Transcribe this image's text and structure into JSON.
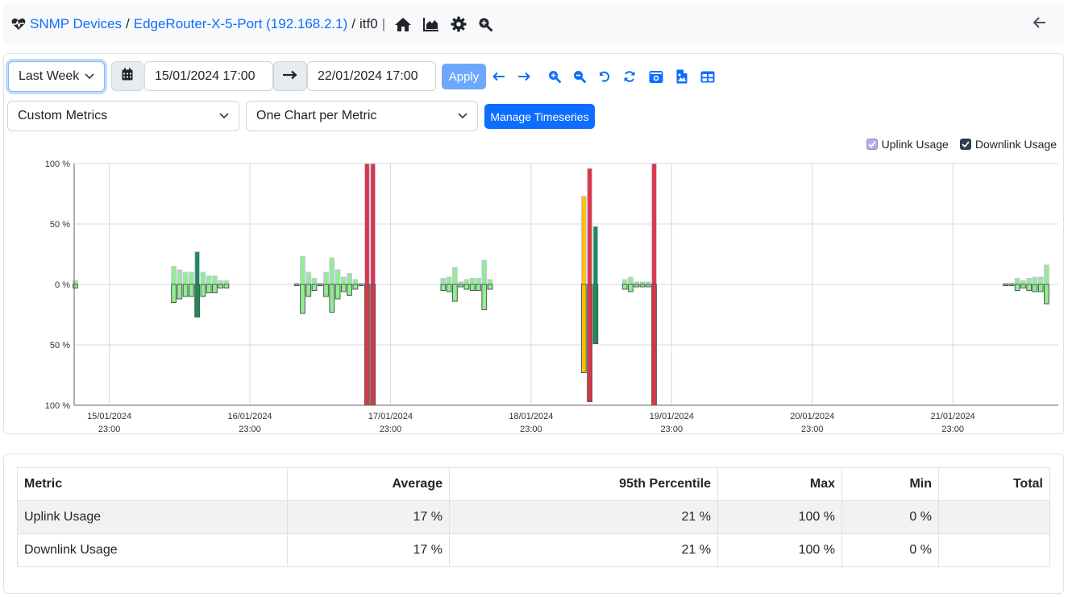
{
  "breadcrumb": {
    "icon": "heartbeat-icon",
    "items": [
      {
        "label": "SNMP Devices",
        "link": true
      },
      {
        "label": "EdgeRouter-X-5-Port (192.168.2.1)",
        "link": true
      },
      {
        "label": "itf0",
        "link": false
      }
    ],
    "separator": "/",
    "divider": "|",
    "nav_icons": [
      "home-icon",
      "area-chart-icon",
      "gear-icon",
      "search-plus-icon"
    ],
    "back_icon": "arrow-left-icon"
  },
  "toolbar": {
    "range_select": "Last Week",
    "calendar_icon": "calendar-icon",
    "start": "15/01/2024 17:00",
    "arrow_icon": "long-arrow-right-icon",
    "end": "22/01/2024 17:00",
    "apply_label": "Apply",
    "tools": [
      "arrow-left-icon",
      "arrow-right-icon",
      "zoom-in-icon",
      "zoom-out-icon",
      "undo-icon",
      "refresh-icon",
      "camera-icon",
      "file-image-icon",
      "table-icon"
    ],
    "metric_select": "Custom Metrics",
    "layout_select": "One Chart per Metric",
    "manage_label": "Manage Timeseries"
  },
  "legend": [
    {
      "label": "Uplink Usage",
      "checked": true,
      "color": "#b4b0e8"
    },
    {
      "label": "Downlink Usage",
      "checked": true,
      "color": "#2c3e50"
    }
  ],
  "colors": {
    "low": "#90ee90",
    "medium": "#1e8a57",
    "high": "#ffc107",
    "critical": "#dc3545",
    "uplink_border": "#c9c3e6",
    "downlink_border": "#4a5a52"
  },
  "chart_data": {
    "type": "bar",
    "title": "",
    "xlabel": "",
    "ylabel": "",
    "ylim": [
      -100,
      100
    ],
    "yticks": [
      "100 %",
      "50 %",
      "0 %",
      "50 %",
      "100 %"
    ],
    "ytick_values": [
      100,
      50,
      0,
      -50,
      -100
    ],
    "x_range_hours": [
      0,
      168
    ],
    "x_start": "15/01/2024 17:00",
    "xticks": [
      {
        "hour": 6,
        "label": [
          "15/01/2024",
          "23:00"
        ]
      },
      {
        "hour": 30,
        "label": [
          "16/01/2024",
          "23:00"
        ]
      },
      {
        "hour": 54,
        "label": [
          "17/01/2024",
          "23:00"
        ]
      },
      {
        "hour": 78,
        "label": [
          "18/01/2024",
          "23:00"
        ]
      },
      {
        "hour": 102,
        "label": [
          "19/01/2024",
          "23:00"
        ]
      },
      {
        "hour": 126,
        "label": [
          "20/01/2024",
          "23:00"
        ]
      },
      {
        "hour": 150,
        "label": [
          "21/01/2024",
          "23:00"
        ]
      }
    ],
    "grid": true,
    "legend_position": "top-right",
    "series": [
      {
        "name": "Uplink Usage",
        "direction": "up"
      },
      {
        "name": "Downlink Usage",
        "direction": "down"
      }
    ],
    "points": [
      {
        "hour": 0.2,
        "up": 3,
        "down": 3
      },
      {
        "hour": 17,
        "up": 15,
        "down": 15
      },
      {
        "hour": 18,
        "up": 12,
        "down": 12
      },
      {
        "hour": 19,
        "up": 10,
        "down": 10
      },
      {
        "hour": 20,
        "up": 10,
        "down": 10
      },
      {
        "hour": 21,
        "up": 27,
        "down": 27
      },
      {
        "hour": 22,
        "up": 10,
        "down": 10
      },
      {
        "hour": 23,
        "up": 7,
        "down": 7
      },
      {
        "hour": 24,
        "up": 7,
        "down": 7
      },
      {
        "hour": 25,
        "up": 3,
        "down": 3
      },
      {
        "hour": 26,
        "up": 3,
        "down": 3
      },
      {
        "hour": 38,
        "up": 0,
        "down": 0
      },
      {
        "hour": 39,
        "up": 23,
        "down": 24
      },
      {
        "hour": 40,
        "up": 10,
        "down": 10
      },
      {
        "hour": 41,
        "up": 5,
        "down": 5
      },
      {
        "hour": 42,
        "up": 1,
        "down": 1
      },
      {
        "hour": 43,
        "up": 10,
        "down": 10
      },
      {
        "hour": 44,
        "up": 22,
        "down": 23
      },
      {
        "hour": 45,
        "up": 12,
        "down": 12
      },
      {
        "hour": 46,
        "up": 6,
        "down": 6
      },
      {
        "hour": 47,
        "up": 9,
        "down": 9
      },
      {
        "hour": 48,
        "up": 4,
        "down": 4
      },
      {
        "hour": 49,
        "up": 1,
        "down": 1
      },
      {
        "hour": 50,
        "up": 100,
        "down": 100
      },
      {
        "hour": 51,
        "up": 100,
        "down": 100
      },
      {
        "hour": 63,
        "up": 5,
        "down": 5
      },
      {
        "hour": 64,
        "up": 6,
        "down": 6
      },
      {
        "hour": 65,
        "up": 14,
        "down": 14
      },
      {
        "hour": 66,
        "up": 2,
        "down": 2
      },
      {
        "hour": 67,
        "up": 4,
        "down": 4
      },
      {
        "hour": 68,
        "up": 5,
        "down": 5
      },
      {
        "hour": 69,
        "up": 5,
        "down": 5
      },
      {
        "hour": 70,
        "up": 20,
        "down": 21
      },
      {
        "hour": 71,
        "up": 4,
        "down": 4
      },
      {
        "hour": 87,
        "up": 73,
        "down": 73
      },
      {
        "hour": 88,
        "up": 96,
        "down": 97
      },
      {
        "hour": 89,
        "up": 48,
        "down": 49
      },
      {
        "hour": 94,
        "up": 4,
        "down": 4
      },
      {
        "hour": 95,
        "up": 6,
        "down": 6
      },
      {
        "hour": 96,
        "up": 2,
        "down": 2
      },
      {
        "hour": 97,
        "up": 2,
        "down": 2
      },
      {
        "hour": 98,
        "up": 2,
        "down": 2
      },
      {
        "hour": 99,
        "up": 100,
        "down": 100
      },
      {
        "hour": 159,
        "up": 0,
        "down": 0
      },
      {
        "hour": 160,
        "up": 0,
        "down": 0
      },
      {
        "hour": 161,
        "up": 5,
        "down": 5
      },
      {
        "hour": 162,
        "up": 3,
        "down": 3
      },
      {
        "hour": 163,
        "up": 5,
        "down": 5
      },
      {
        "hour": 164,
        "up": 6,
        "down": 6
      },
      {
        "hour": 165,
        "up": 6,
        "down": 6
      },
      {
        "hour": 166,
        "up": 16,
        "down": 16
      }
    ]
  },
  "stats_table": {
    "columns": [
      "Metric",
      "Average",
      "95th Percentile",
      "Max",
      "Min",
      "Total"
    ],
    "rows": [
      [
        "Uplink Usage",
        "17 %",
        "21 %",
        "100 %",
        "0 %",
        ""
      ],
      [
        "Downlink Usage",
        "17 %",
        "21 %",
        "100 %",
        "0 %",
        ""
      ]
    ]
  }
}
